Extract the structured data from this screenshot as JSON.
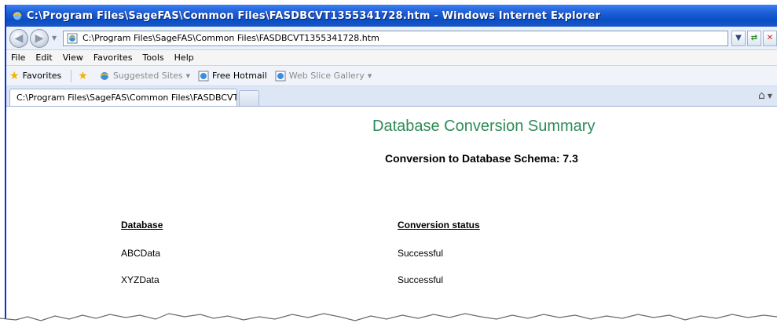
{
  "window": {
    "title": "C:\\Program Files\\SageFAS\\Common Files\\FASDBCVT1355341728.htm - Windows Internet Explorer"
  },
  "address": {
    "url": "C:\\Program Files\\SageFAS\\Common Files\\FASDBCVT1355341728.htm"
  },
  "menu": [
    "File",
    "Edit",
    "View",
    "Favorites",
    "Tools",
    "Help"
  ],
  "favorites": {
    "label": "Favorites",
    "items": [
      "Suggested Sites",
      "Free Hotmail",
      "Web Slice Gallery"
    ]
  },
  "tabs": [
    {
      "label": "C:\\Program Files\\SageFAS\\Common Files\\FASDBCVT1..."
    }
  ],
  "page": {
    "title": "Database Conversion Summary",
    "subtitle": "Conversion to Database Schema: 7.3",
    "table": {
      "headers": [
        "Database",
        "Conversion status"
      ],
      "rows": [
        [
          "ABCData",
          "Successful"
        ],
        [
          "XYZData",
          "Successful"
        ]
      ]
    }
  },
  "colors": {
    "titlebar": "#0a4ec6",
    "heading_green": "#2e8b57"
  },
  "icons": [
    "ie-icon",
    "back-icon",
    "forward-icon",
    "page-icon",
    "refresh-icon",
    "stop-icon",
    "star-icon",
    "home-icon"
  ]
}
